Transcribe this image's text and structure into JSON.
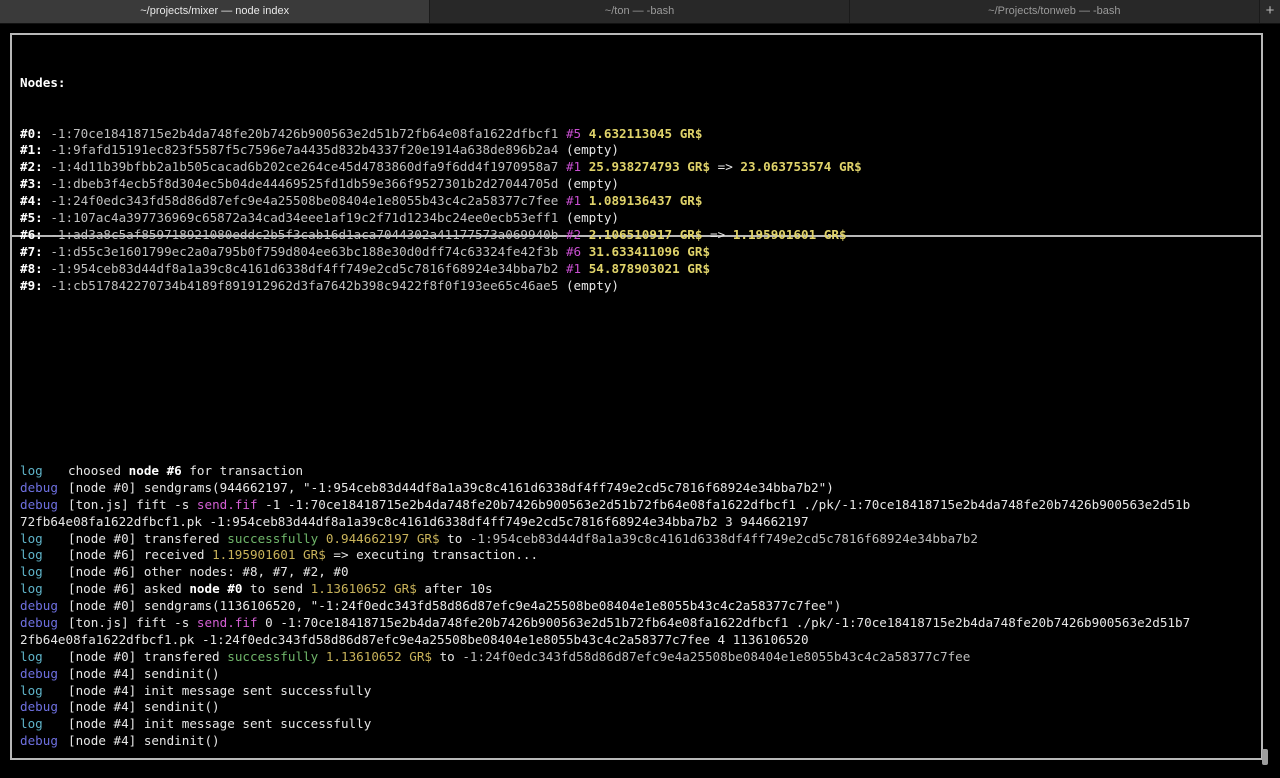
{
  "tabs": [
    {
      "label": "~/projects/mixer — node index",
      "active": true
    },
    {
      "label": "~/ton — -bash",
      "active": false
    },
    {
      "label": "~/Projects/tonweb — -bash",
      "active": false
    }
  ],
  "new_tab_label": "+",
  "nodes": {
    "heading": "Nodes:",
    "arrow": "=>",
    "currency": "GR$",
    "items": [
      {
        "index": "#0:",
        "address": "-1:70ce18418715e2b4da748fe20b7426b900563e2d51b72fb64e08fa1622dfbcf1",
        "peer": "#5",
        "balance": "4.632113045",
        "new_balance": "",
        "empty": ""
      },
      {
        "index": "#1:",
        "address": "-1:9fafd15191ec823f5587f5c7596e7a4435d832b4337f20e1914a638de896b2a4",
        "peer": "",
        "balance": "",
        "new_balance": "",
        "empty": "(empty)"
      },
      {
        "index": "#2:",
        "address": "-1:4d11b39bfbb2a1b505cacad6b202ce264ce45d4783860dfa9f6dd4f1970958a7",
        "peer": "#1",
        "balance": "25.938274793",
        "new_balance": "23.063753574",
        "empty": ""
      },
      {
        "index": "#3:",
        "address": "-1:dbeb3f4ecb5f8d304ec5b04de44469525fd1db59e366f9527301b2d27044705d",
        "peer": "",
        "balance": "",
        "new_balance": "",
        "empty": "(empty)"
      },
      {
        "index": "#4:",
        "address": "-1:24f0edc343fd58d86d87efc9e4a25508be08404e1e8055b43c4c2a58377c7fee",
        "peer": "#1",
        "balance": "1.089136437",
        "new_balance": "",
        "empty": ""
      },
      {
        "index": "#5:",
        "address": "-1:107ac4a397736969c65872a34cad34eee1af19c2f71d1234bc24ee0ecb53eff1",
        "peer": "",
        "balance": "",
        "new_balance": "",
        "empty": "(empty)"
      },
      {
        "index": "#6:",
        "address": "-1:ad3a8c5af859718921080eddc2b5f3cab16d1aca7044302a41177573a069940b",
        "peer": "#2",
        "balance": "2.106510917",
        "new_balance": "1.195901601",
        "empty": ""
      },
      {
        "index": "#7:",
        "address": "-1:d55c3e1601799ec2a0a795b0f759d804ee63bc188e30d0dff74c63324fe42f3b",
        "peer": "#6",
        "balance": "31.633411096",
        "new_balance": "",
        "empty": ""
      },
      {
        "index": "#8:",
        "address": "-1:954ceb83d44df8a1a39c8c4161d6338df4ff749e2cd5c7816f68924e34bba7b2",
        "peer": "#1",
        "balance": "54.878903021",
        "new_balance": "",
        "empty": ""
      },
      {
        "index": "#9:",
        "address": "-1:cb517842270734b4189f891912962d3fa7642b398c9422f8f0f193ee65c46ae5",
        "peer": "",
        "balance": "",
        "new_balance": "",
        "empty": "(empty)"
      }
    ]
  },
  "log": [
    {
      "level": "log",
      "segments": [
        {
          "t": "choosed ",
          "c": "w"
        },
        {
          "t": "node #6",
          "c": "b"
        },
        {
          "t": " for transaction",
          "c": "w"
        }
      ]
    },
    {
      "level": "debug",
      "segments": [
        {
          "t": "[node #0] sendgrams(944662197, \"-1:954ceb83d44df8a1a39c8c4161d6338df4ff749e2cd5c7816f68924e34bba7b2\")",
          "c": "w"
        }
      ]
    },
    {
      "level": "debug",
      "segments": [
        {
          "t": "[ton.js] fift -s ",
          "c": "w"
        },
        {
          "t": "send.fif",
          "c": "pink"
        },
        {
          "t": " -1 -1:70ce18418715e2b4da748fe20b7426b900563e2d51b72fb64e08fa1622dfbcf1 ./pk/-1:70ce18418715e2b4da748fe20b7426b900563e2d51b",
          "c": "w"
        }
      ]
    },
    {
      "level": "",
      "segments": [
        {
          "t": "72fb64e08fa1622dfbcf1.pk -1:954ceb83d44df8a1a39c8c4161d6338df4ff749e2cd5c7816f68924e34bba7b2 3 944662197",
          "c": "w"
        }
      ]
    },
    {
      "level": "log",
      "segments": [
        {
          "t": "[node #0] transfered ",
          "c": "w"
        },
        {
          "t": "successfully",
          "c": "grn"
        },
        {
          "t": " ",
          "c": "w"
        },
        {
          "t": "0.944662197 GR$",
          "c": "olive"
        },
        {
          "t": " to ",
          "c": "w"
        },
        {
          "t": "-1:954ceb83d44df8a1a39c8c4161d6338df4ff749e2cd5c7816f68924e34bba7b2",
          "c": "dim"
        }
      ]
    },
    {
      "level": "log",
      "segments": [
        {
          "t": "[node #6] received ",
          "c": "w"
        },
        {
          "t": "1.195901601 GR$",
          "c": "olive"
        },
        {
          "t": " => executing transaction...",
          "c": "w"
        }
      ]
    },
    {
      "level": "log",
      "segments": [
        {
          "t": "[node #6] other nodes: #8, #7, #2, #0",
          "c": "w"
        }
      ]
    },
    {
      "level": "log",
      "segments": [
        {
          "t": "[node #6] asked ",
          "c": "w"
        },
        {
          "t": "node #0",
          "c": "b"
        },
        {
          "t": " to send ",
          "c": "w"
        },
        {
          "t": "1.13610652 GR$",
          "c": "olive"
        },
        {
          "t": " after 10s",
          "c": "w"
        }
      ]
    },
    {
      "level": "debug",
      "segments": [
        {
          "t": "[node #0] sendgrams(1136106520, \"-1:24f0edc343fd58d86d87efc9e4a25508be08404e1e8055b43c4c2a58377c7fee\")",
          "c": "w"
        }
      ]
    },
    {
      "level": "debug",
      "segments": [
        {
          "t": "[ton.js] fift -s ",
          "c": "w"
        },
        {
          "t": "send.fif",
          "c": "pink"
        },
        {
          "t": " 0 -1:70ce18418715e2b4da748fe20b7426b900563e2d51b72fb64e08fa1622dfbcf1 ./pk/-1:70ce18418715e2b4da748fe20b7426b900563e2d51b7",
          "c": "w"
        }
      ]
    },
    {
      "level": "",
      "segments": [
        {
          "t": "2fb64e08fa1622dfbcf1.pk -1:24f0edc343fd58d86d87efc9e4a25508be08404e1e8055b43c4c2a58377c7fee 4 1136106520",
          "c": "w"
        }
      ]
    },
    {
      "level": "log",
      "segments": [
        {
          "t": "[node #0] transfered ",
          "c": "w"
        },
        {
          "t": "successfully",
          "c": "grn"
        },
        {
          "t": " ",
          "c": "w"
        },
        {
          "t": "1.13610652 GR$",
          "c": "olive"
        },
        {
          "t": " to ",
          "c": "w"
        },
        {
          "t": "-1:24f0edc343fd58d86d87efc9e4a25508be08404e1e8055b43c4c2a58377c7fee",
          "c": "dim"
        }
      ]
    },
    {
      "level": "debug",
      "segments": [
        {
          "t": "[node #4] sendinit()",
          "c": "w"
        }
      ]
    },
    {
      "level": "log",
      "segments": [
        {
          "t": "[node #4] init message sent successfully",
          "c": "w"
        }
      ]
    },
    {
      "level": "debug",
      "segments": [
        {
          "t": "[node #4] sendinit()",
          "c": "w"
        }
      ]
    },
    {
      "level": "log",
      "segments": [
        {
          "t": "[node #4] init message sent successfully",
          "c": "w"
        }
      ]
    },
    {
      "level": "debug",
      "segments": [
        {
          "t": "[node #4] sendinit()",
          "c": "w"
        }
      ]
    }
  ]
}
